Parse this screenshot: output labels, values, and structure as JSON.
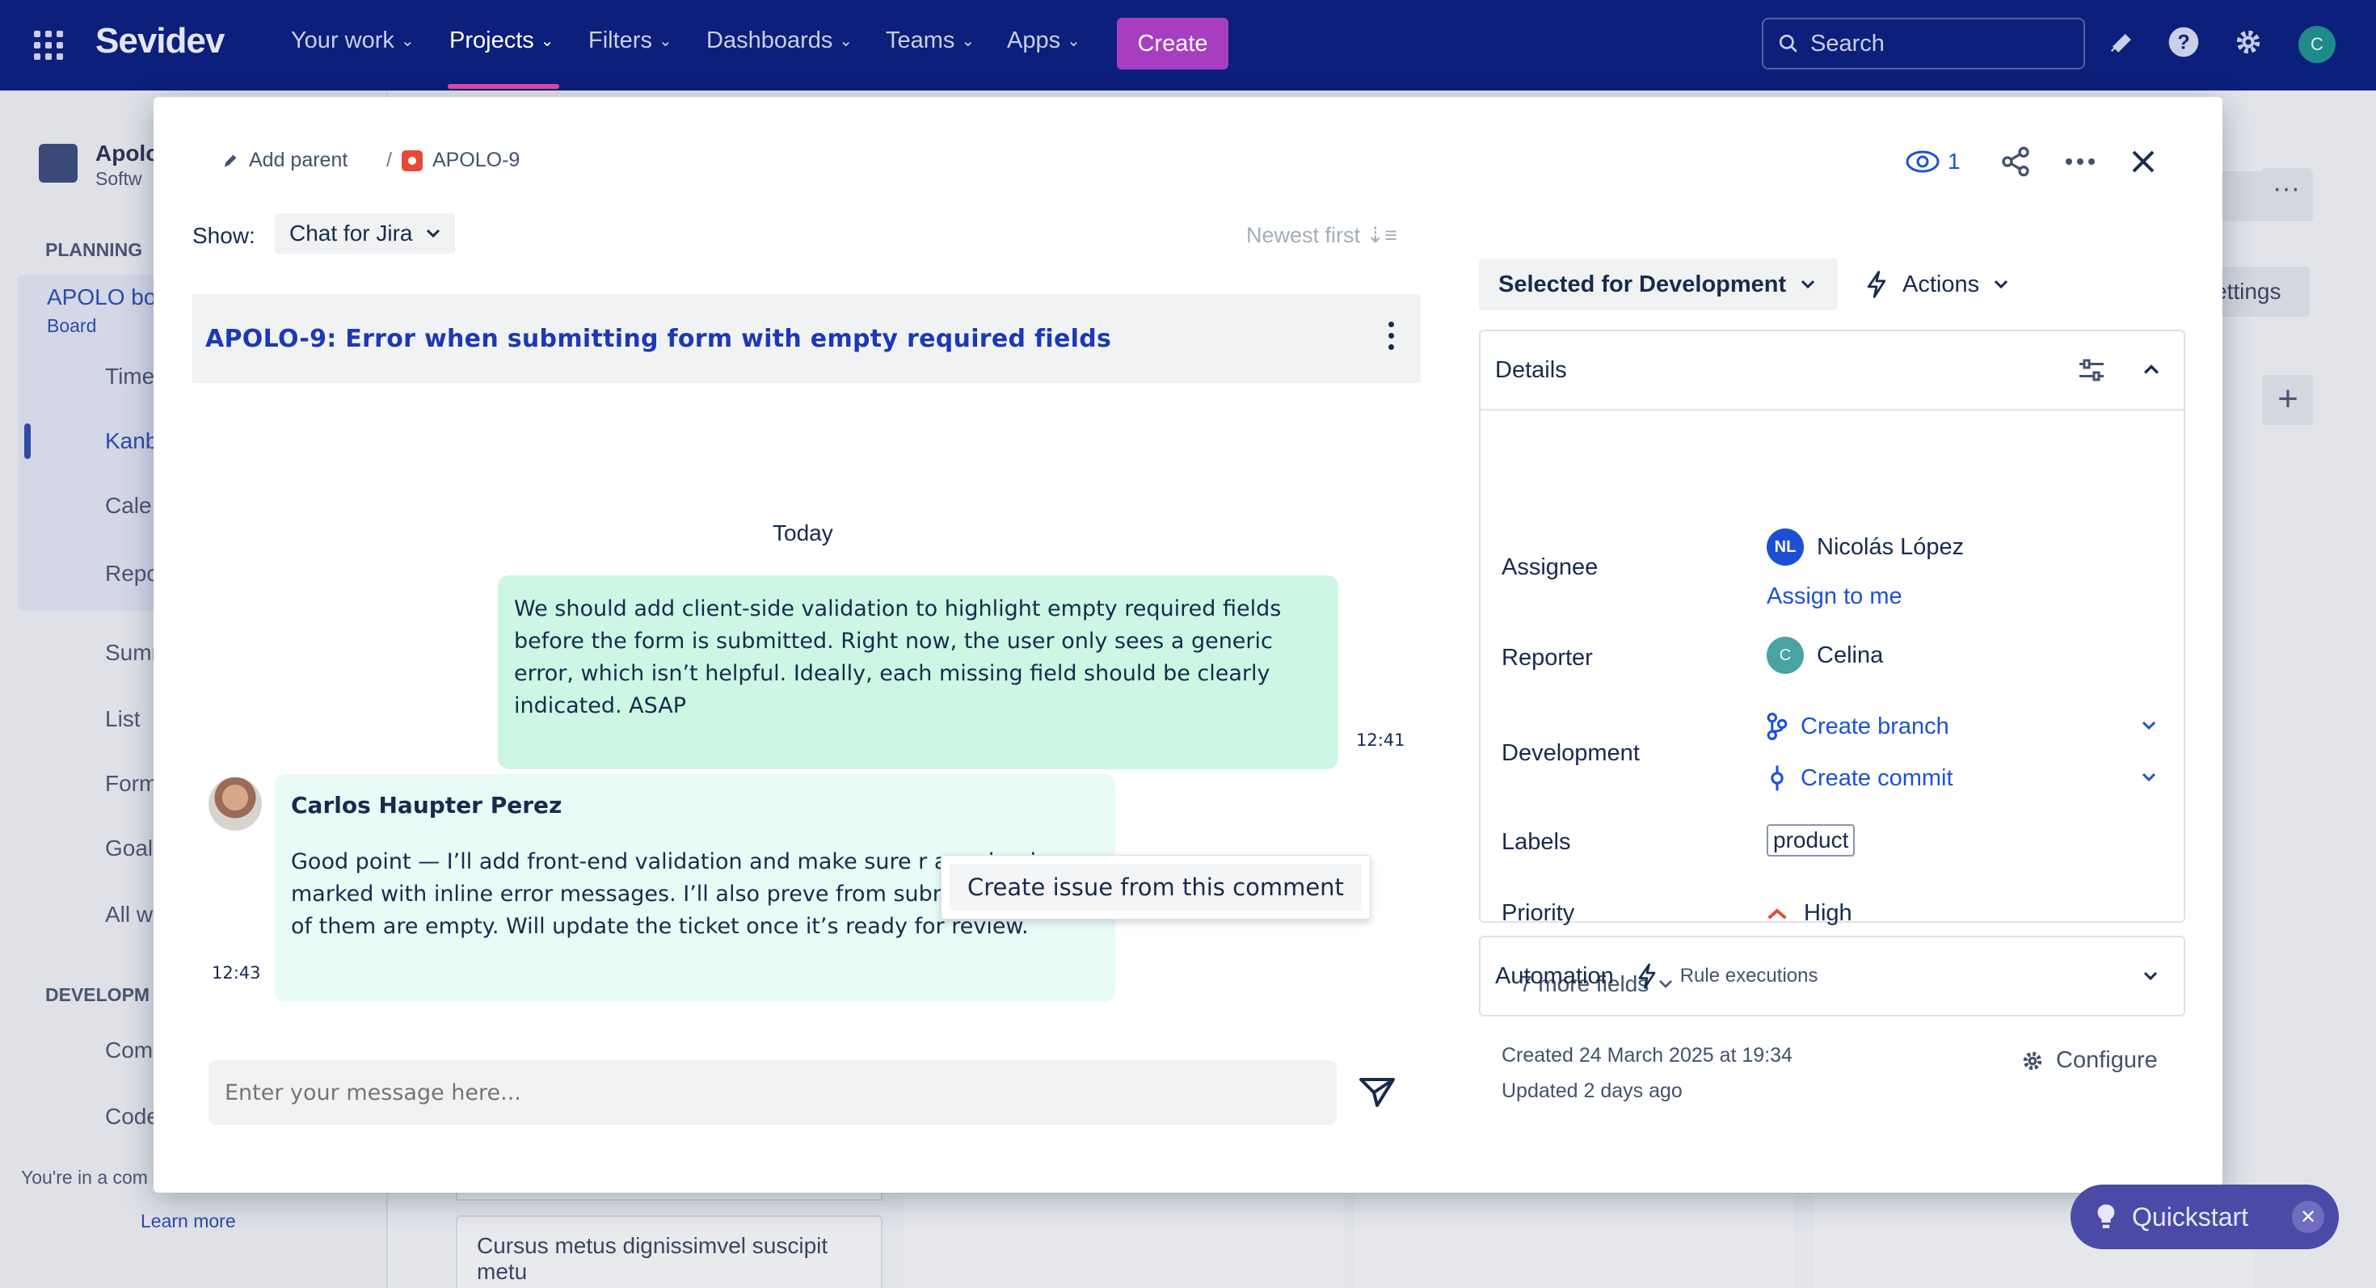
{
  "topnav": {
    "logo": "Sevidev",
    "items": [
      {
        "label": "Your work"
      },
      {
        "label": "Projects"
      },
      {
        "label": "Filters"
      },
      {
        "label": "Dashboards"
      },
      {
        "label": "Teams"
      },
      {
        "label": "Apps"
      }
    ],
    "create_label": "Create",
    "search_placeholder": "Search",
    "avatar_initial": "C"
  },
  "background": {
    "project_name": "Apolo",
    "project_type": "Softw",
    "planning_heading": "PLANNING",
    "board_name": "APOLO bo",
    "board_sub": "Board",
    "nav": [
      "Time",
      "Kanb",
      "Cale",
      "Repo",
      "Summ",
      "List",
      "Form",
      "Goals",
      "All w"
    ],
    "development_heading": "DEVELOPM",
    "dev_nav": [
      "Comp",
      "Code"
    ],
    "footer_text": "You're in a com",
    "learn_more": "Learn more",
    "card_text": "Cursus metus dignissimvel suscipit metu",
    "settings_fragment": "ettings"
  },
  "modal": {
    "add_parent": "Add parent",
    "issue_key": "APOLO-9",
    "watch_count": "1",
    "show_label": "Show:",
    "show_value": "Chat for Jira",
    "sort_label": "Newest first",
    "issue_title": "APOLO-9: Error when submitting form with empty required fields",
    "day_label": "Today",
    "outgoing": {
      "text": "We should add client-side validation to highlight empty required fields before the form is submitted. Right now, the user only sees a generic error, which isn’t helpful. Ideally, each missing field should be clearly indicated. ASAP",
      "time": "12:41"
    },
    "incoming": {
      "author": "Carlos Haupter Perez",
      "text": "Good point — I’ll add front-end validation and make sure r are clearly marked with inline error messages. I’ll also preve from submitting if any of them are empty. Will update the ticket once it’s ready for review.",
      "time": "12:43"
    },
    "context_menu_item": "Create issue from this comment",
    "message_placeholder": "Enter your message here..."
  },
  "panel": {
    "status": "Selected for Development",
    "actions": "Actions",
    "details_title": "Details",
    "fields": {
      "assignee_label": "Assignee",
      "assignee_initials": "NL",
      "assignee_name": "Nicolás López",
      "assign_to_me": "Assign to me",
      "reporter_label": "Reporter",
      "reporter_initial": "C",
      "reporter_name": "Celina",
      "development_label": "Development",
      "create_branch": "Create branch",
      "create_commit": "Create commit",
      "labels_label": "Labels",
      "label_value": "product",
      "priority_label": "Priority",
      "priority_value": "High"
    },
    "more_fields": "7 more fields",
    "automation_title": "Automation",
    "automation_sub": "Rule executions",
    "created": "Created 24 March 2025 at 19:34",
    "updated": "Updated 2 days ago",
    "configure": "Configure"
  },
  "quickstart": {
    "label": "Quickstart"
  },
  "colors": {
    "nav_bg": "#0c1f7a",
    "create": "#a73ec1",
    "accent_link": "#1d52d6",
    "bubble_out": "#cbf7e4",
    "bubble_in": "#e8fbf6"
  }
}
